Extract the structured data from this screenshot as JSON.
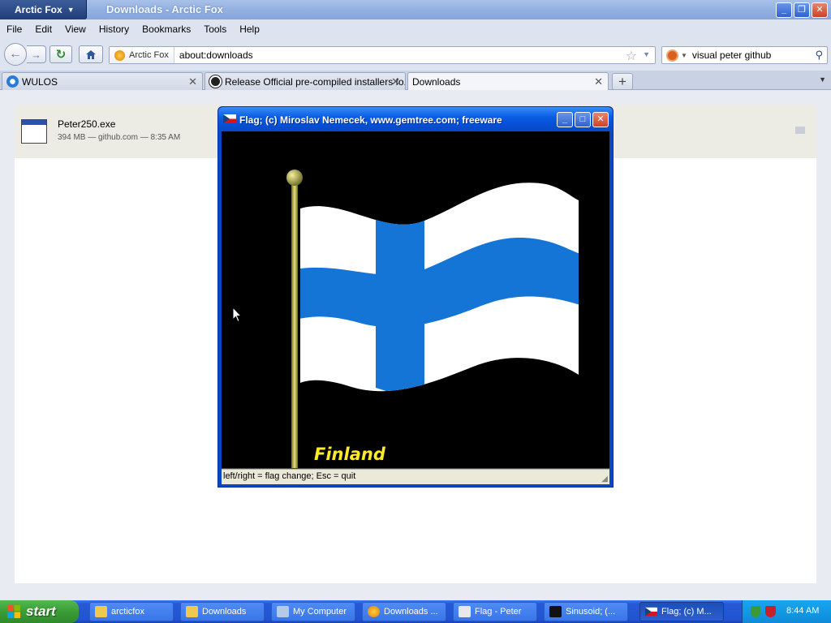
{
  "browser": {
    "app_button": "Arctic Fox",
    "window_title": "Downloads - Arctic Fox",
    "menu": [
      "File",
      "Edit",
      "View",
      "History",
      "Bookmarks",
      "Tools",
      "Help"
    ],
    "identity_label": "Arctic Fox",
    "url": "about:downloads",
    "search_text": "visual peter github",
    "tabs": [
      {
        "label": "WULOS"
      },
      {
        "label": "Release Official pre-compiled installers fo..."
      },
      {
        "label": "Downloads"
      }
    ]
  },
  "download": {
    "filename": "Peter250.exe",
    "meta": "394 MB — github.com — 8:35 AM"
  },
  "flag_window": {
    "title": "Flag;   (c) Miroslav Nemecek, www.gemtree.com;   freeware",
    "country": "Finland",
    "status": "left/right = flag change;   Esc = quit"
  },
  "taskbar": {
    "start": "start",
    "tasks": [
      {
        "label": "arcticfox"
      },
      {
        "label": "Downloads"
      },
      {
        "label": "My Computer"
      },
      {
        "label": "Downloads ..."
      },
      {
        "label": "Flag - Peter"
      },
      {
        "label": "Sinusoid;   (..."
      },
      {
        "label": "Flag;   (c) M..."
      }
    ],
    "clock": "8:44 AM"
  },
  "colors": {
    "flag_blue": "#1475d6",
    "flag_white": "#ffffff",
    "label_yellow": "#ffea2a",
    "xp_blue": "#0a5ee4",
    "start_green": "#3a9d36"
  }
}
